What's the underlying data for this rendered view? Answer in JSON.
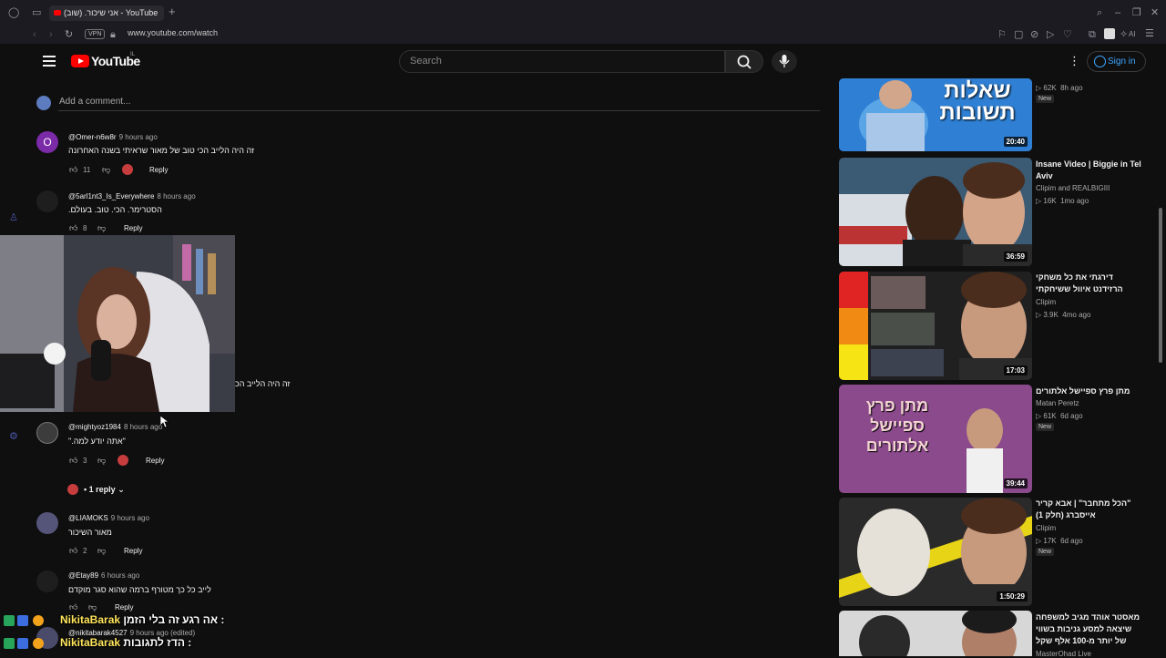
{
  "browser": {
    "tab_title": "אני שיכור. (שוב) - YouTube",
    "url": "www.youtube.com/watch",
    "vpn_label": "VPN",
    "ai_label": "AI"
  },
  "header": {
    "logo_text": "YouTube",
    "country_code": "IL",
    "search_placeholder": "Search",
    "sign_in": "Sign in"
  },
  "comments": {
    "add_placeholder": "Add a comment...",
    "reply_label": "Reply",
    "items": [
      {
        "author": "@Omer-n6w8r",
        "time": "9 hours ago",
        "text": "זה היה הלייב הכי טוב של מאור שראיתי בשנה האחרונה",
        "likes": "11",
        "avatar_letter": "O"
      },
      {
        "author": "@5arl1nt3_Is_Everywhere",
        "time": "8 hours ago",
        "text": "הסטרימר. הכי. טוב. בעולם.",
        "likes": "8"
      },
      {
        "author": "@mightyoz1984",
        "time": "8 hours ago",
        "text": "\"אתה יודע למה.\"",
        "likes": "3",
        "replies": "1 reply"
      },
      {
        "author": "@LIAMOKS",
        "time": "9 hours ago",
        "text": "מאור השיכור",
        "likes": "2"
      },
      {
        "author": "@Etay89",
        "time": "6 hours ago",
        "text": "לייב כל כך  מטורף  ברמה שהוא סגר מוקדם",
        "likes": ""
      },
      {
        "author": "@nikitabarak4527",
        "time": "9 hours ago (edited)",
        "text": "",
        "likes": ""
      }
    ],
    "partial_text": "זה היה הלייב הכ"
  },
  "sidebar": {
    "videos": [
      {
        "title": "",
        "channel": "",
        "views": "62K",
        "age": "8h ago",
        "badge": "New",
        "duration": "20:40",
        "thumb_text": "שאלות תשובות"
      },
      {
        "title": "Insane Video | Biggie in Tel Aviv",
        "channel": "Clipim and REALBIGIII",
        "views": "16K",
        "age": "1mo ago",
        "duration": "36:59"
      },
      {
        "title": "דירגתי את כל משחקי הרזידנט איוול ששיחקתי",
        "channel": "Clipim",
        "views": "3.9K",
        "age": "4mo ago",
        "duration": "17:03"
      },
      {
        "title": "מתן פרץ ספיישל אלתורים",
        "channel": "Matan Peretz",
        "views": "61K",
        "age": "6d ago",
        "badge": "New",
        "duration": "39:44",
        "thumb_text": "מתן פרץ ספיישל אלתורים"
      },
      {
        "title": "\"הכל מתחבר\" | אבא קריר אייסברג (חלק 1)",
        "channel": "Clipim",
        "views": "17K",
        "age": "6d ago",
        "badge": "New",
        "duration": "1:50:29"
      },
      {
        "title": "מאסטר אוהד מגיב למשפחה שיצאה למסע גניבות בשווי של יותר מ-100 אלף שקל",
        "channel": "MasterOhad Live",
        "views": "",
        "age": ""
      }
    ]
  },
  "chat_overlay": [
    {
      "user": "NikitaBarak",
      "message": "אה רגע זה בלי הזמן :"
    },
    {
      "user": "NikitaBarak",
      "message": "הדז לתגובות :"
    }
  ],
  "colors": {
    "brand_red": "#ff0000",
    "link_blue": "#3ea6ff",
    "background": "#0f0f0f",
    "chat_name": "#ffe55c"
  }
}
